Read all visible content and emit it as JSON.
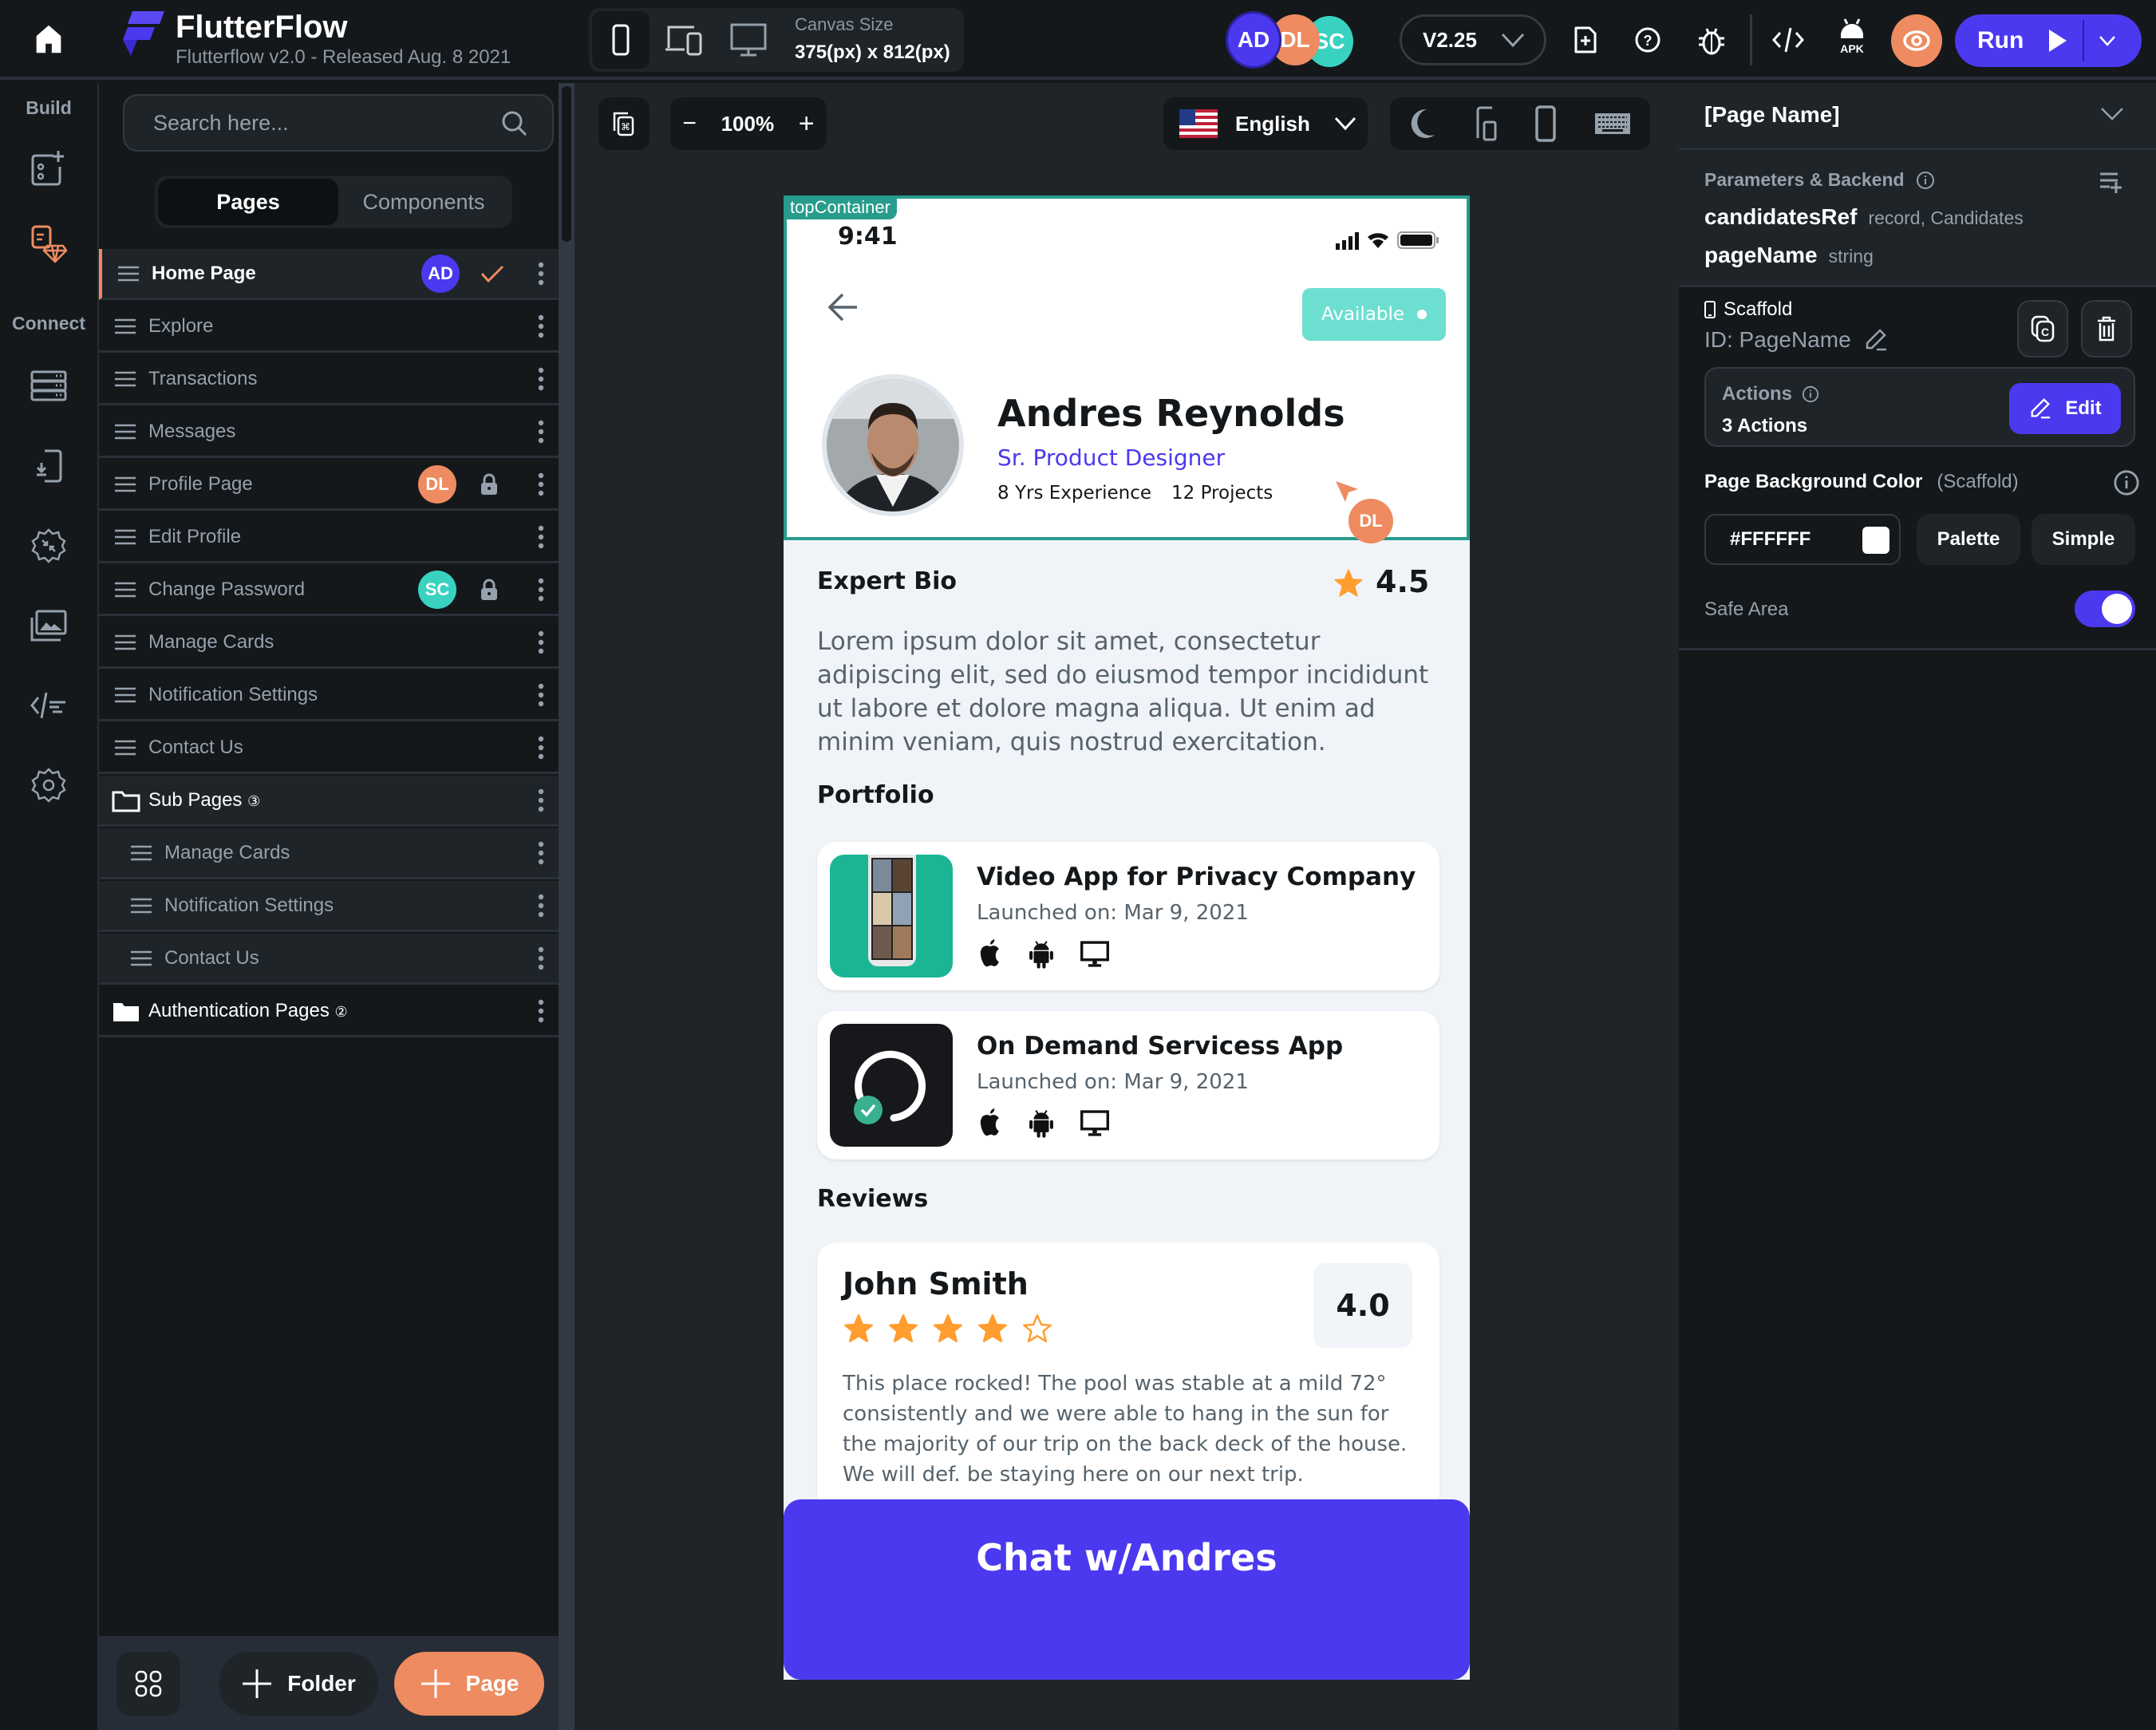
{
  "app": {
    "title": "FlutterFlow",
    "subtitle": "Flutterflow v2.0 - Released Aug. 8 2021",
    "brand_color": "#4b39ef",
    "accent_orange": "#ee8b60",
    "accent_teal": "#39d2c0"
  },
  "topbar": {
    "canvas_size_label": "Canvas Size",
    "canvas_size_value": "375(px) x 812(px)",
    "collaborators": [
      {
        "initials": "AD",
        "color": "#4b39ef"
      },
      {
        "initials": "DL",
        "color": "#ee8b60"
      },
      {
        "initials": "SC",
        "color": "#39d2c0"
      }
    ],
    "version": "V2.25",
    "apk_label": "APK",
    "run_label": "Run"
  },
  "rail": {
    "build_label": "Build",
    "connect_label": "Connect"
  },
  "pages_panel": {
    "search_placeholder": "Search here...",
    "tabs": [
      "Pages",
      "Components"
    ],
    "active_tab": "Pages",
    "items": [
      {
        "label": "Home Page",
        "active": true,
        "avatar": "AD",
        "status": "check"
      },
      {
        "label": "Explore"
      },
      {
        "label": "Transactions"
      },
      {
        "label": "Messages"
      },
      {
        "label": "Profile Page",
        "avatar": "DL",
        "status": "lock"
      },
      {
        "label": "Edit Profile"
      },
      {
        "label": "Change Password",
        "avatar": "SC",
        "status": "lock"
      },
      {
        "label": "Manage Cards"
      },
      {
        "label": "Notification Settings"
      },
      {
        "label": "Contact Us"
      }
    ],
    "folders": [
      {
        "label": "Sub Pages",
        "count": "③",
        "children": [
          "Manage Cards",
          "Notification Settings",
          "Contact Us"
        ]
      },
      {
        "label": "Authentication Pages",
        "count": "②"
      }
    ],
    "folder_button": "Folder",
    "page_button": "Page"
  },
  "canvas_toolbar": {
    "zoom": "100%",
    "language": "English"
  },
  "phone": {
    "container_tag": "topContainer",
    "status_time": "9:41",
    "availability": "Available",
    "name": "Andres Reynolds",
    "role": "Sr. Product Designer",
    "experience": "8 Yrs Experience",
    "projects": "12 Projects",
    "cursor_user": "DL",
    "bio_title": "Expert Bio",
    "rating": "4.5",
    "bio": "Lorem ipsum dolor sit amet, consectetur adipiscing elit, sed do eiusmod tempor incididunt ut labore et dolore magna aliqua. Ut enim ad minim veniam, quis nostrud exercitation.",
    "portfolio_title": "Portfolio",
    "portfolio": [
      {
        "title": "Video App for Privacy Company",
        "launched": "Launched on: Mar 9, 2021"
      },
      {
        "title": "On Demand Servicess App",
        "launched": "Launched on: Mar 9, 2021"
      }
    ],
    "reviews_title": "Reviews",
    "review": {
      "name": "John Smith",
      "score": "4.0",
      "stars": 4,
      "max_stars": 5,
      "text": "This place rocked! The pool was stable at a mild 72° consistently and we were able to hang in the sun for the majority of our trip on the back deck of the house. We will def. be staying here on our next trip."
    },
    "cta": "Chat w/Andres"
  },
  "right_panel": {
    "page_name": "[Page Name]",
    "params_title": "Parameters & Backend",
    "params": [
      {
        "name": "candidatesRef",
        "type": "record, Candidates"
      },
      {
        "name": "pageName",
        "type": "string"
      }
    ],
    "scaffold_label": "Scaffold",
    "scaffold_id": "ID: PageName",
    "actions_label": "Actions",
    "actions_count": "3 Actions",
    "edit_label": "Edit",
    "bg_color_label": "Page Background Color",
    "bg_color_scope": "(Scaffold)",
    "bg_color_value": "#FFFFFF",
    "palette_label": "Palette",
    "simple_label": "Simple",
    "safe_area_label": "Safe Area",
    "safe_area_on": true
  }
}
